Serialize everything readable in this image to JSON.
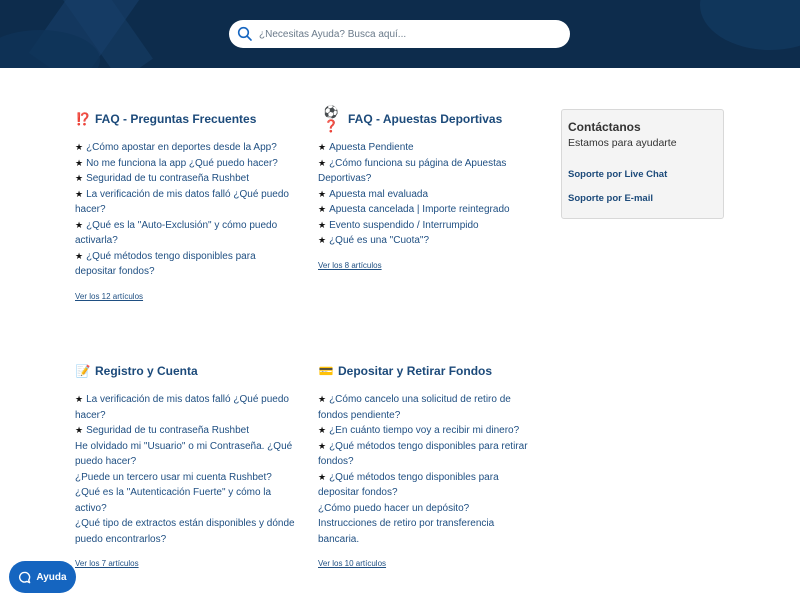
{
  "search": {
    "placeholder": "¿Necesitas Ayuda? Busca aquí..."
  },
  "sections": [
    {
      "title": "FAQ - Preguntas Frecuentes",
      "emoji": "⁉️",
      "items": [
        {
          "star": true,
          "text": "¿Cómo apostar en deportes desde la App?"
        },
        {
          "star": true,
          "text": "No me funciona la app ¿Qué puedo hacer?"
        },
        {
          "star": true,
          "text": "Seguridad de tu contraseña Rushbet"
        },
        {
          "star": true,
          "text": "La verificación de mis datos falló ¿Qué puedo hacer?"
        },
        {
          "star": true,
          "text": "¿Qué es la \"Auto-Exclusión\" y cómo puedo activarla?"
        },
        {
          "star": true,
          "text": "¿Qué métodos tengo disponibles para depositar fondos?"
        }
      ],
      "more": "Ver los 12 artículos"
    },
    {
      "title": "FAQ - Apuestas Deportivas",
      "emoji": "⚽❓",
      "items": [
        {
          "star": true,
          "text": "Apuesta Pendiente"
        },
        {
          "star": true,
          "text": "¿Cómo funciona su página de Apuestas Deportivas?"
        },
        {
          "star": true,
          "text": "Apuesta mal evaluada"
        },
        {
          "star": true,
          "text": "Apuesta cancelada | Importe reintegrado"
        },
        {
          "star": true,
          "text": "Evento suspendido / Interrumpido"
        },
        {
          "star": true,
          "text": "¿Qué es una \"Cuota\"?"
        }
      ],
      "more": "Ver los 8 artículos"
    },
    {
      "title": "Registro y Cuenta",
      "emoji": "📝",
      "items": [
        {
          "star": true,
          "text": "La verificación de mis datos falló ¿Qué puedo hacer?"
        },
        {
          "star": true,
          "text": "Seguridad de tu contraseña Rushbet"
        },
        {
          "star": false,
          "text": "He olvidado mi \"Usuario\" o mi Contraseña. ¿Qué puedo hacer?"
        },
        {
          "star": false,
          "text": "¿Puede un tercero usar mi cuenta Rushbet?"
        },
        {
          "star": false,
          "text": "¿Qué es la \"Autenticación Fuerte\" y cómo la activo?"
        },
        {
          "star": false,
          "text": "¿Qué tipo de extractos están disponibles y dónde puedo encontrarlos?"
        }
      ],
      "more": "Ver los 7 artículos"
    },
    {
      "title": "Depositar y Retirar Fondos",
      "emoji": "💳",
      "items": [
        {
          "star": true,
          "text": "¿Cómo cancelo una solicitud de retiro de fondos pendiente?"
        },
        {
          "star": true,
          "text": "¿En cuánto tiempo voy a recibir mi dinero?"
        },
        {
          "star": true,
          "text": "¿Qué métodos tengo disponibles para retirar fondos?"
        },
        {
          "star": true,
          "text": "¿Qué métodos tengo disponibles para depositar fondos?"
        },
        {
          "star": false,
          "text": "¿Cómo puedo hacer un depósito?"
        },
        {
          "star": false,
          "text": "Instrucciones de retiro por transferencia bancaria."
        }
      ],
      "more": "Ver los 10 artículos"
    }
  ],
  "contact": {
    "title": "Contáctanos",
    "subtitle": "Estamos para ayudarte",
    "links": [
      "Soporte por Live Chat",
      "Soporte por E-mail"
    ]
  },
  "help_button": {
    "label": "Ayuda"
  },
  "colors": {
    "header_bg": "#0d2c4c",
    "link": "#1f4f82",
    "help_button": "#1565c0"
  }
}
